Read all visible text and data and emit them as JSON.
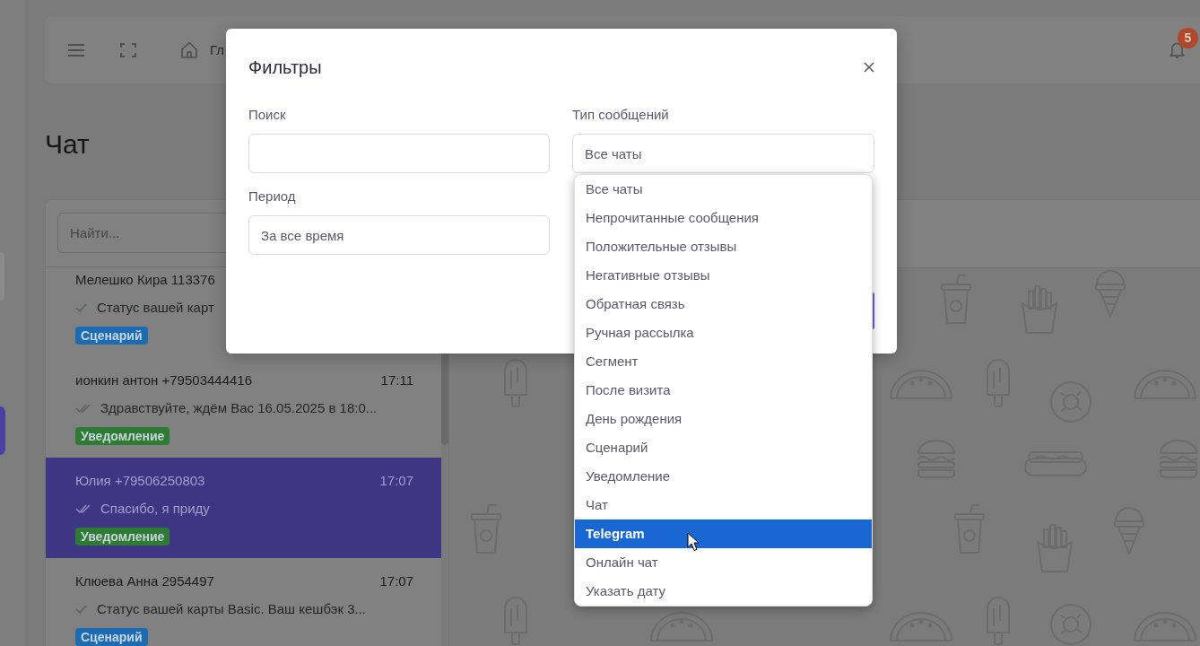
{
  "sidebar": {
    "items": [
      {
        "selected": false
      },
      {
        "selected": true
      }
    ]
  },
  "header": {
    "breadcrumb": "Гл",
    "notification_count": "5"
  },
  "page_title": "Чат",
  "chat_list": {
    "search_placeholder": "Найти...",
    "chats": [
      {
        "name": "Мелешко Кира 113376",
        "preview": "Статус вашей карт",
        "read": false,
        "selected": false,
        "tag": {
          "label": "Сценарий",
          "color": "#1c6cb3"
        }
      },
      {
        "name": "ионкин антон +79503444416",
        "time": "17:11",
        "preview": "Здравствуйте, ждём Вас 16.05.2025 в 18:0...",
        "read": true,
        "selected": false,
        "tag": {
          "label": "Уведомление",
          "color": "#2e7b34"
        }
      },
      {
        "name": "Юлия +79506250803",
        "time": "17:07",
        "preview": "Спасибо, я приду",
        "read": true,
        "selected": true,
        "tag": {
          "label": "Уведомление",
          "color": "#2e7b34"
        }
      },
      {
        "name": "Клюева Анна 2954497",
        "time": "17:07",
        "preview": "Статус вашей карты Basic. Ваш кешбэк 3...",
        "read": false,
        "selected": false,
        "tag": {
          "label": "Сценарий",
          "color": "#1c6cb3"
        }
      }
    ]
  },
  "filters_dialog": {
    "title": "Фильтры",
    "fields": [
      {
        "label": "Поиск",
        "kind": "input"
      },
      {
        "label": "Тип сообщений",
        "kind": "select",
        "value": "Все чаты",
        "expanded": true,
        "options": [
          {
            "label": "Все чаты",
            "highlighted": false
          },
          {
            "label": "Непрочитанные сообщения",
            "highlighted": false
          },
          {
            "label": "Положительные отзывы",
            "highlighted": false
          },
          {
            "label": "Негативные отзывы",
            "highlighted": false
          },
          {
            "label": "Обратная связь",
            "highlighted": false
          },
          {
            "label": "Ручная рассылка",
            "highlighted": false
          },
          {
            "label": "Сегмент",
            "highlighted": false
          },
          {
            "label": "После визита",
            "highlighted": false
          },
          {
            "label": "День рождения",
            "highlighted": false
          },
          {
            "label": "Сценарий",
            "highlighted": false
          },
          {
            "label": "Уведомление",
            "highlighted": false
          },
          {
            "label": "Чат",
            "highlighted": false
          },
          {
            "label": "Telegram",
            "highlighted": true
          },
          {
            "label": "Онлайн чат",
            "highlighted": false
          },
          {
            "label": "Указать дату",
            "highlighted": false
          }
        ]
      },
      {
        "label": "Период",
        "kind": "select",
        "value": "За все время"
      }
    ]
  }
}
